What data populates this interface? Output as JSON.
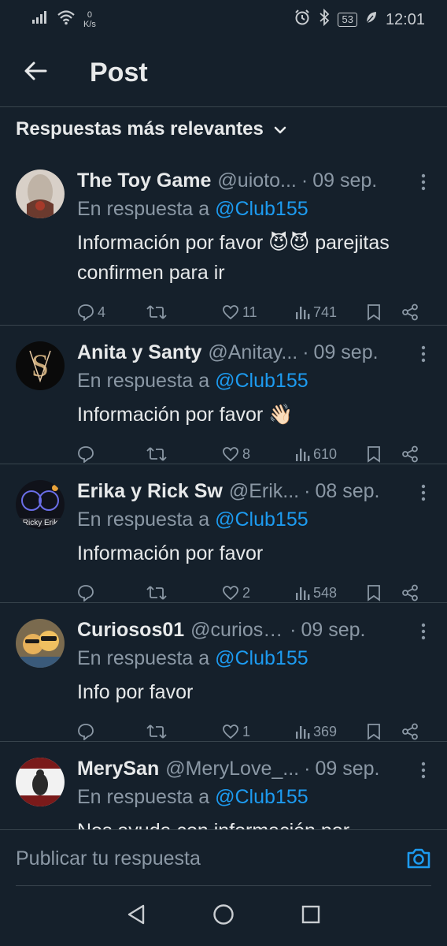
{
  "status_bar": {
    "signal_icon": "signal-icon",
    "wifi_icon": "wifi-icon",
    "speed_value": "0",
    "speed_unit": "K/s",
    "alarm_icon": "alarm-icon",
    "bluetooth_icon": "bluetooth-icon",
    "battery": "53",
    "leaf_icon": "leaf-icon",
    "time": "12:01"
  },
  "header": {
    "back_icon": "arrow-left-icon",
    "title": "Post"
  },
  "sort": {
    "label": "Respuestas más relevantes",
    "icon": "chevron-down-icon"
  },
  "colors": {
    "background": "#15202b",
    "accent": "#1d9bf0",
    "muted": "#8b98a5",
    "text": "#e7e9ea",
    "divider": "#38444d"
  },
  "posts": [
    {
      "name": "The Toy Game",
      "handle": "@uioto...",
      "dot": "·",
      "date": "09 sep.",
      "reply_prefix": "En respuesta a",
      "reply_to": "@Club155",
      "text": "Información por favor 😈😈 parejitas confirmen para ir",
      "replies": "4",
      "retweets": "",
      "likes": "11",
      "views": "741"
    },
    {
      "name": "Anita y Santy",
      "handle": "@Anitay...",
      "dot": "·",
      "date": "09 sep.",
      "reply_prefix": "En respuesta a",
      "reply_to": "@Club155",
      "text": "Información por favor 👋🏻",
      "replies": "",
      "retweets": "",
      "likes": "8",
      "views": "610"
    },
    {
      "name": "Erika y Rick Sw",
      "handle": "@Erik...",
      "dot": "·",
      "date": "08 sep.",
      "reply_prefix": "En respuesta a",
      "reply_to": "@Club155",
      "text": "Información por favor",
      "replies": "",
      "retweets": "",
      "likes": "2",
      "views": "548"
    },
    {
      "name": "Curiosos01",
      "handle": "@curioso...",
      "dot": "·",
      "date": "09 sep.",
      "reply_prefix": "En respuesta a",
      "reply_to": "@Club155",
      "text": "Info por favor",
      "replies": "",
      "retweets": "",
      "likes": "1",
      "views": "369"
    },
    {
      "name": "MerySan",
      "handle": "@MeryLove_...",
      "dot": "·",
      "date": "09 sep.",
      "reply_prefix": "En respuesta a",
      "reply_to": "@Club155",
      "text": "Nos ayuda con información por",
      "replies": "",
      "retweets": "",
      "likes": "",
      "views": ""
    }
  ],
  "composer": {
    "placeholder": "Publicar tu respuesta",
    "camera_icon": "camera-icon"
  },
  "navbar": {
    "back_icon": "triangle-back-icon",
    "home_icon": "circle-home-icon",
    "recents_icon": "square-recents-icon"
  }
}
